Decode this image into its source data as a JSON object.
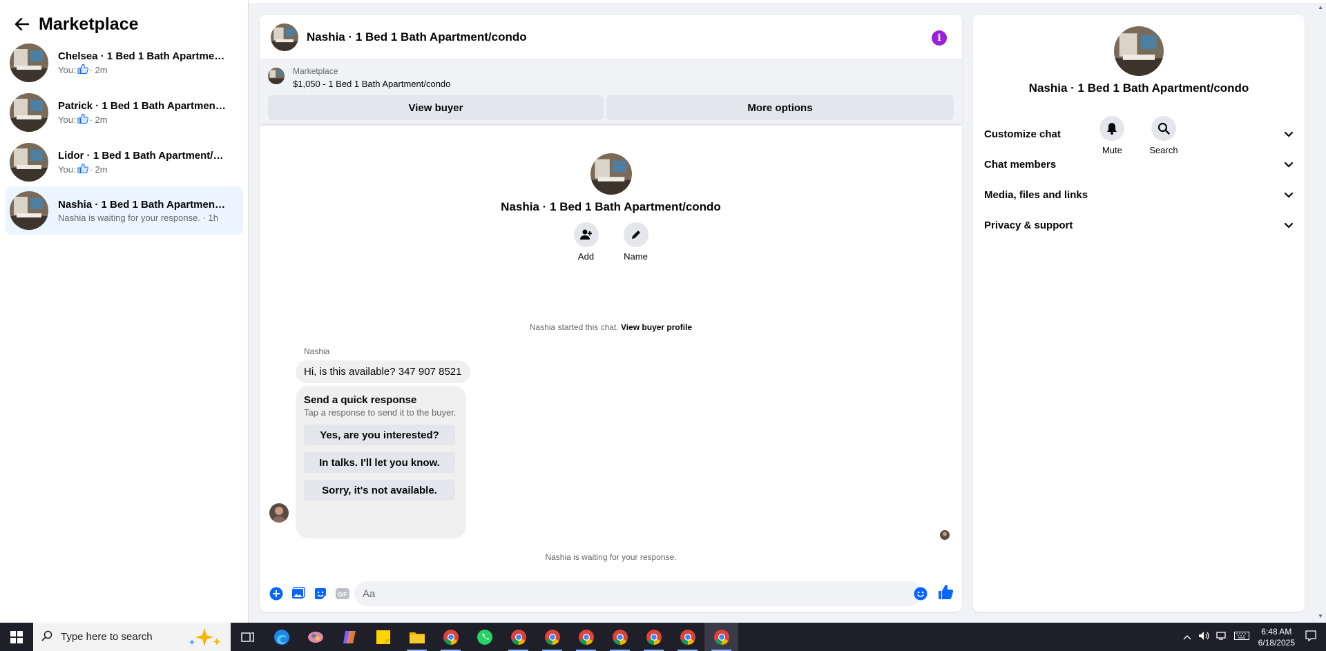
{
  "sidebar": {
    "title": "Marketplace",
    "conversations": [
      {
        "title": "Chelsea · 1 Bed 1 Bath Apartment/...",
        "sub_prefix": "You:",
        "sub_suffix": "· 2m"
      },
      {
        "title": "Patrick · 1 Bed 1 Bath Apartment/c...",
        "sub_prefix": "You:",
        "sub_suffix": "· 2m"
      },
      {
        "title": "Lidor · 1 Bed 1 Bath Apartment/co...",
        "sub_prefix": "You:",
        "sub_suffix": "· 2m"
      },
      {
        "title": "Nashia · 1 Bed 1 Bath Apartment/c...",
        "sub_prefix": "Nashia is waiting for your response.",
        "sub_suffix": "· 1h"
      }
    ]
  },
  "chat": {
    "header_title": "Nashia · 1 Bed 1 Bath Apartment/condo",
    "banner": {
      "label": "Marketplace",
      "price_line": "$1,050 - 1 Bed 1 Bath Apartment/condo",
      "view_buyer": "View buyer",
      "more_options": "More options"
    },
    "profile": {
      "title": "Nashia · 1 Bed 1 Bath Apartment/condo",
      "add_label": "Add",
      "name_label": "Name"
    },
    "started_text": "Nashia started this chat.",
    "view_profile_link": "View buyer profile",
    "sender_name": "Nashia",
    "message": "Hi, is this available? 347 907 8521",
    "quick_response": {
      "title": "Send a quick response",
      "subtitle": "Tap a response to send it to the buyer.",
      "options": [
        "Yes, are you interested?",
        "In talks. I'll let you know.",
        "Sorry, it's not available."
      ]
    },
    "waiting_text": "Nashia is waiting for your response.",
    "composer_placeholder": "Aa"
  },
  "right_panel": {
    "title": "Nashia · 1 Bed 1 Bath Apartment/condo",
    "mute_label": "Mute",
    "search_label": "Search",
    "sections": [
      "Customize chat",
      "Chat members",
      "Media, files and links",
      "Privacy & support"
    ]
  },
  "taskbar": {
    "search_placeholder": "Type here to search",
    "time": "6:48 AM",
    "date": "6/18/2025"
  },
  "colors": {
    "accent": "#0866ff",
    "info_purple": "#9b20d9",
    "active_conv": "#ebf5ff"
  }
}
